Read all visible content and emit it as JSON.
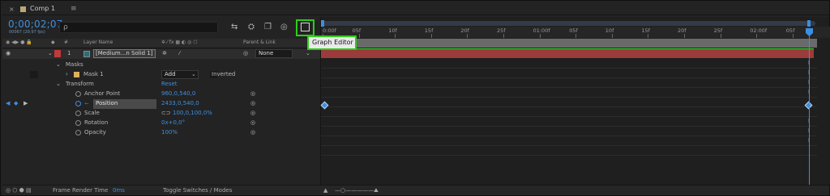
{
  "tab": {
    "title": "Comp 1",
    "close": "×",
    "menu": "≡"
  },
  "header": {
    "timecode": "0;00;02;07",
    "fps": "00067 (29.97 fps)",
    "search_placeholder": "ρ"
  },
  "tooltip": "Graph Editor",
  "columns": {
    "layer_name": "Layer Name",
    "parent_link": "Parent & Link",
    "hash": "#"
  },
  "layer": {
    "index": "1",
    "name": "[Medium...n Solid 1]",
    "parent": "None"
  },
  "rows": {
    "masks": "Masks",
    "mask1": "Mask 1",
    "mask_mode": "Add",
    "inverted": "Inverted",
    "transform": "Transform",
    "reset": "Reset",
    "anchor_label": "Anchor Point",
    "anchor_value": "960,0,540,0",
    "position_label": "Position",
    "position_value": "2433,0,540,0",
    "scale_label": "Scale",
    "scale_value": "100,0,100,0%",
    "rotation_label": "Rotation",
    "rotation_value": "0x+0,0°",
    "opacity_label": "Opacity",
    "opacity_value": "100%"
  },
  "ruler": [
    "0:00f",
    "05f",
    "10f",
    "15f",
    "20f",
    "25f",
    "01:00f",
    "05f",
    "10f",
    "15f",
    "20f",
    "25f",
    "02:00f",
    "05f"
  ],
  "status": {
    "frame_render_label": "Frame Render Time",
    "frame_render_value": "0ms",
    "toggle": "Toggle Switches / Modes"
  },
  "colors": {
    "accent": "#3d8fe0",
    "highlight": "#2ecc1a",
    "layer_bar": "#9b3b3b"
  }
}
